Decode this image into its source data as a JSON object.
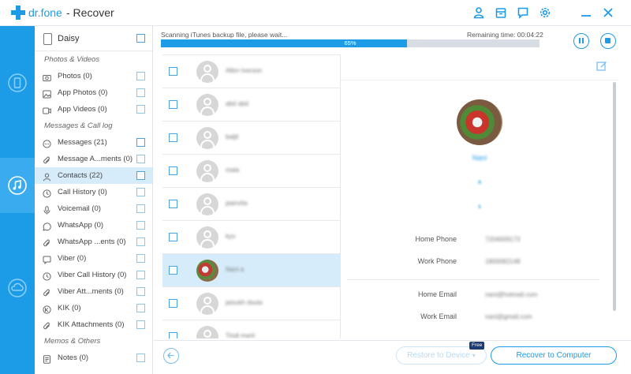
{
  "titlebar": {
    "brand": "dr.fone",
    "title": "- Recover",
    "icons": [
      "user-icon",
      "store-icon",
      "chat-icon",
      "gear-icon",
      "minimize-icon",
      "close-icon"
    ]
  },
  "rail": {
    "items": [
      {
        "name": "device-recover-icon"
      },
      {
        "name": "itunes-recover-icon",
        "active": true
      },
      {
        "name": "icloud-recover-icon"
      }
    ]
  },
  "device": {
    "name": "Daisy"
  },
  "categories": {
    "group1": "Photos & Videos",
    "photos": "Photos (0)",
    "app_photos": "App Photos (0)",
    "app_videos": "App Videos (0)",
    "group2": "Messages & Call log",
    "messages": "Messages (21)",
    "message_attachments": "Message A...ments (0)",
    "contacts": "Contacts (22)",
    "call_history": "Call History (0)",
    "voicemail": "Voicemail (0)",
    "whatsapp": "WhatsApp (0)",
    "whatsapp_attachments": "WhatsApp ...ents (0)",
    "viber": "Viber (0)",
    "viber_call_history": "Viber Call History (0)",
    "viber_attachments": "Viber Att...ments (0)",
    "kik": "KIK (0)",
    "kik_attachments": "KIK Attachments (0)",
    "group3": "Memos & Others",
    "notes": "Notes (0)"
  },
  "scan": {
    "status": "Scanning iTunes backup file, please wait...",
    "remaining": "Remaining time: 00:04:22",
    "progress": 0.65,
    "progress_label": "65%"
  },
  "contacts": [
    {
      "name": "Allen Iverson"
    },
    {
      "name": "abd abd"
    },
    {
      "name": "baljit"
    },
    {
      "name": "mala"
    },
    {
      "name": "jaanvita"
    },
    {
      "name": "kyo"
    },
    {
      "name": "Nani a",
      "selected": true
    },
    {
      "name": "jaisukh dsuta"
    },
    {
      "name": "Tindi marit"
    }
  ],
  "detail": {
    "name": "Nani",
    "line1": "a",
    "line2": "s",
    "fields": [
      {
        "label": "Home Phone",
        "value": "7204009173"
      },
      {
        "label": "Work Phone",
        "value": "1800082148"
      },
      {
        "label": "Home Email",
        "value": "nani@hotmail.com"
      },
      {
        "label": "Work Email",
        "value": "nani@gmail.com"
      }
    ]
  },
  "footer": {
    "restore_label": "Restore to Device",
    "free_badge": "Free",
    "recover_label": "Recover to Computer"
  },
  "colors": {
    "accent": "#1c9be6",
    "selected_row": "#d6ecfa",
    "progress_track": "#d8dde3"
  }
}
